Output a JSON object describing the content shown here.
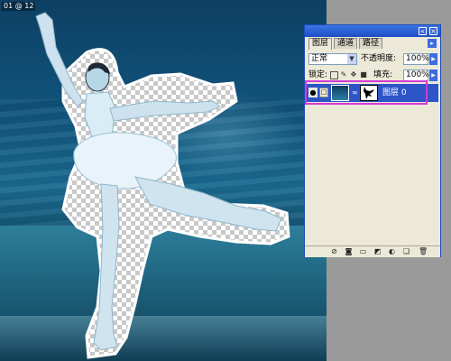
{
  "document": {
    "corner_tag": "01 @ 12"
  },
  "layers_palette": {
    "titlebar_buttons": {
      "minimize": "«",
      "close": "×"
    },
    "tabs": [
      {
        "label": "图层",
        "active": true
      },
      {
        "label": "通道",
        "active": false
      },
      {
        "label": "路径",
        "active": false
      }
    ],
    "menu_icon": "▸",
    "blend_mode": "正常",
    "opacity_label": "不透明度:",
    "opacity_value": "100%",
    "lock_label": "锁定:",
    "lock_icons": [
      "transparency-lock-icon",
      "image-lock-icon",
      "position-lock-icon",
      "all-lock-icon"
    ],
    "fill_label": "填充:",
    "fill_value": "100%",
    "layer": {
      "name": "图层 0",
      "visible": true,
      "selected": true
    },
    "footer_icons": [
      "link-layers-icon",
      "layer-style-icon",
      "add-mask-icon",
      "new-group-icon",
      "adjustment-layer-icon",
      "new-layer-icon",
      "trash-icon"
    ],
    "colors": {
      "titlebar": "#2d5ed4",
      "selected_row": "#2d55c8",
      "highlight_frame": "#d43ad4",
      "panel_bg": "#ece9d8"
    }
  }
}
